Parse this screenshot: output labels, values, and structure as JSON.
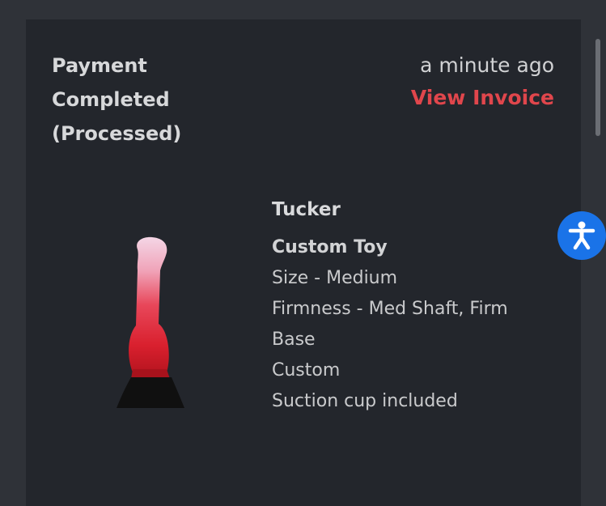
{
  "notification": {
    "status_lines": [
      "Payment",
      "Completed",
      "(Processed)"
    ],
    "time": "a minute ago",
    "invoice_link": "View Invoice"
  },
  "product": {
    "name": "Tucker",
    "type": "Custom Toy",
    "options": [
      "Size - Medium",
      "Firmness - Med Shaft, Firm",
      "Base",
      "Custom",
      "Suction cup included"
    ],
    "image_icon": "product-photo"
  },
  "accessibility": {
    "icon": "accessibility-icon",
    "color": "#1a73e8"
  },
  "colors": {
    "background": "#2f3238",
    "card": "#23262c",
    "link": "#e0464c"
  }
}
